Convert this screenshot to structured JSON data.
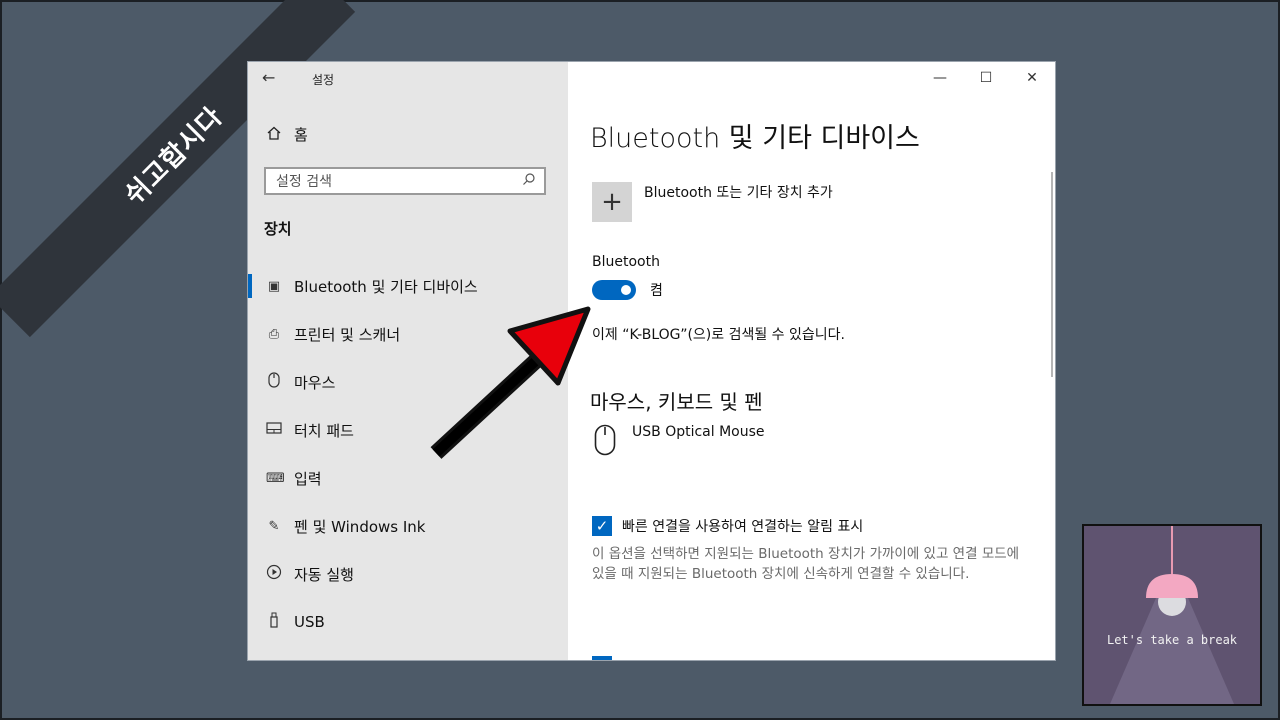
{
  "banner": {
    "text": "쉬고합시다"
  },
  "window": {
    "title": "설정",
    "controls": {
      "minimize": "—",
      "maximize": "☐",
      "close": "✕"
    }
  },
  "sidebar": {
    "home_label": "홈",
    "search_placeholder": "설정 검색",
    "section_label": "장치",
    "items": [
      {
        "label": "Bluetooth 및 기타 디바이스",
        "icon": "bluetooth-device-icon",
        "active": true
      },
      {
        "label": "프린터 및 스캐너",
        "icon": "printer-icon"
      },
      {
        "label": "마우스",
        "icon": "mouse-icon"
      },
      {
        "label": "터치 패드",
        "icon": "touchpad-icon"
      },
      {
        "label": "입력",
        "icon": "keyboard-icon"
      },
      {
        "label": "펜 및 Windows Ink",
        "icon": "pen-icon"
      },
      {
        "label": "자동 실행",
        "icon": "autoplay-icon"
      },
      {
        "label": "USB",
        "icon": "usb-icon"
      }
    ]
  },
  "content": {
    "title": "Bluetooth 및 기타 디바이스",
    "add_device_label": "Bluetooth 또는 기타 장치 추가",
    "bluetooth_label": "Bluetooth",
    "toggle_state": "켬",
    "toggle_on": true,
    "discoverable_text": "이제 “K-BLOG”(으)로 검색될 수 있습니다.",
    "mouse_section_title": "마우스, 키보드 및 펜",
    "device_name": "USB Optical Mouse",
    "swift_pair_label": "빠른 연결을 사용하여 연결하는 알림 표시",
    "swift_pair_checked": true,
    "swift_pair_desc": "이 옵션을 선택하면 지원되는 Bluetooth 장치가 가까이에 있고 연결 모드에 있을 때 지원되는 Bluetooth 장치에 신속하게 연결할 수 있습니다."
  },
  "overlay": {
    "break_text": "Let's take a break"
  },
  "colors": {
    "accent": "#0067c0",
    "arrow": "#e8000b",
    "background": "#4d5a68"
  }
}
